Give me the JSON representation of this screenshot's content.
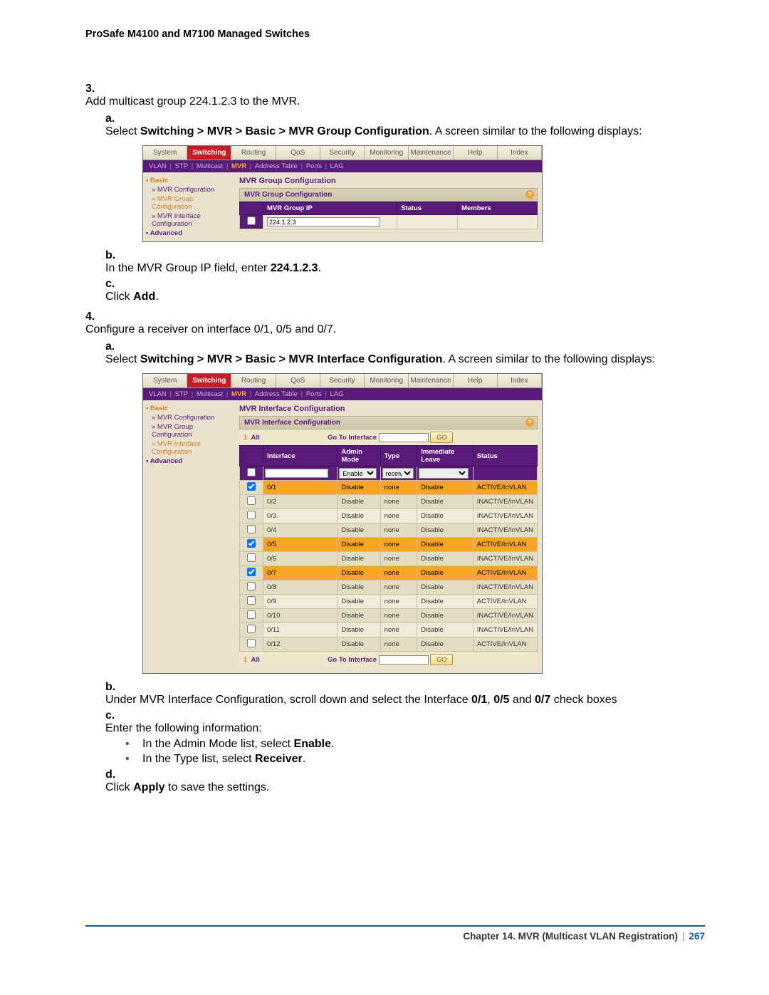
{
  "header": "ProSafe M4100 and M7100 Managed Switches",
  "step3": {
    "num": "3.",
    "text": "Add multicast group 224.1.2.3 to the MVR.",
    "a_lbl": "a.",
    "a_pre": "Select ",
    "a_bold": "Switching > MVR > Basic > MVR Group Configuration",
    "a_post": ". A screen similar to the following displays:",
    "b_lbl": "b.",
    "b_pre": "In the MVR Group IP field, enter ",
    "b_bold": "224.1.2.3",
    "b_post": ".",
    "c_lbl": "c.",
    "c_pre": "Click ",
    "c_bold": "Add",
    "c_post": "."
  },
  "step4": {
    "num": "4.",
    "text": "Configure a receiver on interface 0/1, 0/5 and 0/7.",
    "a_lbl": "a.",
    "a_pre": "Select ",
    "a_bold": "Switching > MVR > Basic > MVR Interface Configuration",
    "a_post": ". A screen similar to the following displays:",
    "b_lbl": "b.",
    "b_pre": "Under MVR Interface Configuration, scroll down and select the Interface ",
    "b_b1": "0/1",
    "b_mid1": ", ",
    "b_b2": "0/5",
    "b_mid2": " and ",
    "b_b3": "0/7",
    "b_post": " check boxes",
    "c_lbl": "c.",
    "c_text": "Enter the following information:",
    "c_bul1_pre": "In the Admin Mode list, select ",
    "c_bul1_b": "Enable",
    "c_bul1_post": ".",
    "c_bul2_pre": "In the Type list, select ",
    "c_bul2_b": "Receiver",
    "c_bul2_post": ".",
    "d_lbl": "d.",
    "d_pre": "Click ",
    "d_bold": "Apply",
    "d_post": " to save the settings."
  },
  "tabs": [
    "System",
    "Switching",
    "Routing",
    "QoS",
    "Security",
    "Monitoring",
    "Maintenance",
    "Help",
    "Index"
  ],
  "subnav": {
    "items": [
      "VLAN",
      "STP",
      "Multicast",
      "MVR",
      "Address Table",
      "Ports",
      "LAG"
    ],
    "sel": "MVR"
  },
  "shot1": {
    "title": "MVR Group Configuration",
    "panel": "MVR Group Configuration",
    "sidebar_cat": "Basic",
    "sidebar_links": [
      "MVR Configuration",
      "MVR Group Configuration",
      "MVR Interface Configuration"
    ],
    "sidebar_sel": "MVR Group Configuration",
    "sidebar_cat2": "Advanced",
    "cols": [
      "",
      "MVR Group IP",
      "Status",
      "Members"
    ],
    "ip": "224.1.2.3"
  },
  "shot2": {
    "title": "MVR Interface Configuration",
    "panel": "MVR Interface Configuration",
    "sidebar_cat": "Basic",
    "sidebar_links": [
      "MVR Configuration",
      "MVR Group Configuration",
      "MVR Interface Configuration"
    ],
    "sidebar_sel": "MVR Interface Configuration",
    "sidebar_cat2": "Advanced",
    "all": "All",
    "goto": "Go To Interface",
    "go": "GO",
    "one": "1",
    "cols": [
      "",
      "Interface",
      "Admin Mode",
      "Type",
      "Immediate Leave",
      "Status"
    ],
    "filter_mode": "Enable",
    "filter_type": "receiver",
    "rows": [
      {
        "if": "0/1",
        "mode": "Disable",
        "type": "none",
        "leave": "Disable",
        "status": "ACTIVE/InVLAN",
        "chk": true,
        "hl": true
      },
      {
        "if": "0/2",
        "mode": "Disable",
        "type": "none",
        "leave": "Disable",
        "status": "INACTIVE/InVLAN",
        "chk": false,
        "alt": true
      },
      {
        "if": "0/3",
        "mode": "Disable",
        "type": "none",
        "leave": "Disable",
        "status": "INACTIVE/InVLAN",
        "chk": false
      },
      {
        "if": "0/4",
        "mode": "Disable",
        "type": "none",
        "leave": "Disable",
        "status": "INACTIVE/InVLAN",
        "chk": false,
        "alt": true
      },
      {
        "if": "0/5",
        "mode": "Disable",
        "type": "none",
        "leave": "Disable",
        "status": "ACTIVE/InVLAN",
        "chk": true,
        "hl": true
      },
      {
        "if": "0/6",
        "mode": "Disable",
        "type": "none",
        "leave": "Disable",
        "status": "INACTIVE/InVLAN",
        "chk": false,
        "alt": true
      },
      {
        "if": "0/7",
        "mode": "Disable",
        "type": "none",
        "leave": "Disable",
        "status": "ACTIVE/InVLAN",
        "chk": true,
        "hl": true
      },
      {
        "if": "0/8",
        "mode": "Disable",
        "type": "none",
        "leave": "Disable",
        "status": "INACTIVE/InVLAN",
        "chk": false,
        "alt": true
      },
      {
        "if": "0/9",
        "mode": "Disable",
        "type": "none",
        "leave": "Disable",
        "status": "ACTIVE/InVLAN",
        "chk": false
      },
      {
        "if": "0/10",
        "mode": "Disable",
        "type": "none",
        "leave": "Disable",
        "status": "INACTIVE/InVLAN",
        "chk": false,
        "alt": true
      },
      {
        "if": "0/11",
        "mode": "Disable",
        "type": "none",
        "leave": "Disable",
        "status": "INACTIVE/InVLAN",
        "chk": false
      },
      {
        "if": "0/12",
        "mode": "Disable",
        "type": "none",
        "leave": "Disable",
        "status": "ACTIVE/InVLAN",
        "chk": false,
        "alt": true
      }
    ]
  },
  "footer": {
    "chapter": "Chapter 14.  MVR (Multicast VLAN Registration)",
    "page": "267"
  }
}
